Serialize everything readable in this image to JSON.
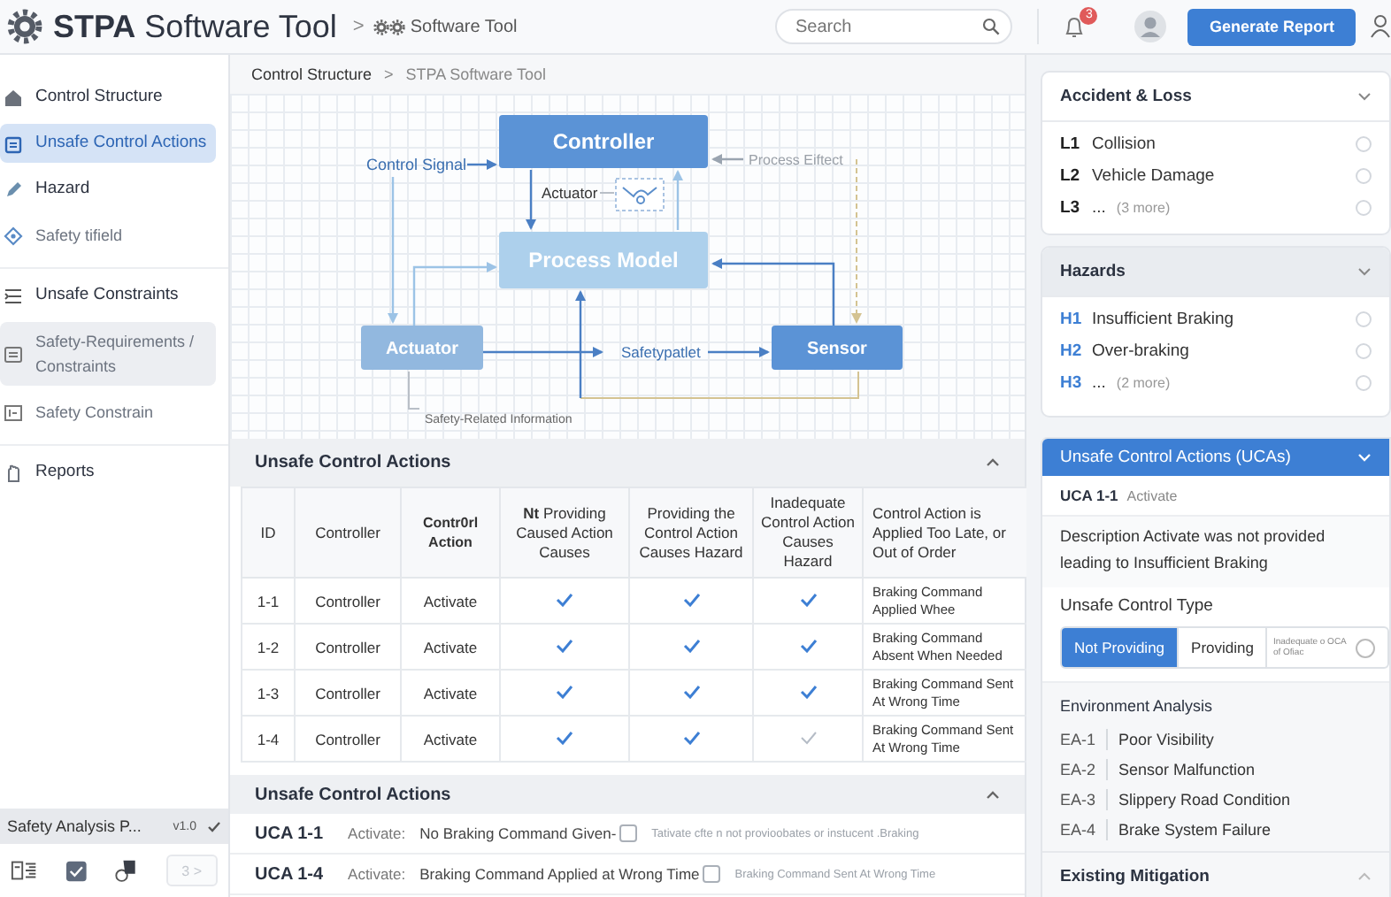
{
  "header": {
    "app_title": "**STPA** Software Tool",
    "breadcrumb_separator": ">",
    "breadcrumb": "Software Tool",
    "search": {
      "placeholder": "Search"
    },
    "notification_count": "3",
    "button": "Generate Report"
  },
  "sidebar": {
    "groups": [
      {
        "items": [
          {
            "label": "Control Structure",
            "kind": "heading",
            "selected": false,
            "highlighted": false
          },
          {
            "label": "Unsafe Control Actions",
            "kind": "heading",
            "selected": true,
            "highlighted": false
          },
          {
            "label": "Hazard",
            "kind": "heading",
            "selected": false,
            "highlighted": false
          },
          {
            "label": "Safety tifield",
            "kind": "item",
            "selected": false,
            "highlighted": false
          }
        ]
      },
      {
        "items": [
          {
            "label": "Unsafe Constraints",
            "kind": "heading",
            "selected": false,
            "highlighted": false
          },
          {
            "label": "Safety-Requirements / Constraints",
            "kind": "item",
            "selected": false,
            "highlighted": true
          },
          {
            "label": "Safety Constrain",
            "kind": "item",
            "selected": false,
            "highlighted": false
          }
        ]
      },
      {
        "items": [
          {
            "label": "Reports",
            "kind": "heading",
            "selected": false,
            "highlighted": false
          }
        ]
      }
    ],
    "status": {
      "project": "Safety Analysis P...",
      "version": "v1.0"
    },
    "page_button": {
      "label": "3 >",
      "disabled": true
    }
  },
  "breadcrumb": {
    "items": [
      "Control Structure",
      "STPA Software Tool"
    ],
    "separator": ">"
  },
  "diagram": {
    "nodes": [
      {
        "label": "Controller",
        "kind": "primary"
      },
      {
        "label": "Process Model",
        "kind": "faded"
      },
      {
        "label": "Actuator",
        "kind": "secondary"
      },
      {
        "label": "Sensor",
        "kind": "primary"
      }
    ],
    "labels": [
      {
        "text": "Control Signal",
        "kind": "signal"
      },
      {
        "text": "Process Eiftect",
        "kind": "effect"
      },
      {
        "text": "Actuator",
        "kind": "plain"
      },
      {
        "text": "Safetypatlet",
        "kind": "flow"
      },
      {
        "text": "Safety-Related Information",
        "kind": "note"
      }
    ]
  },
  "uca_table": {
    "title": "Unsafe Control Actions",
    "columns": [
      {
        "label": "ID",
        "emphasis": false
      },
      {
        "label": "Controller",
        "emphasis": false
      },
      {
        "label": "Contr0rl Action",
        "emphasis": true
      },
      {
        "label": "**Nt** Providing Caused Action Causes",
        "emphasis": false
      },
      {
        "label": "Providing the Control Action Causes Hazard",
        "emphasis": false
      },
      {
        "label": "Inadequate Control Action Causes Hazard",
        "emphasis": false
      },
      {
        "label": "Control Action is Applied Too Late, or Out of Order",
        "emphasis": false
      }
    ],
    "rows": [
      {
        "id": "1-1",
        "controller": "Controller",
        "action": "Activate",
        "checks": [
          true,
          true,
          true
        ],
        "context": "Braking Command Applied Whee"
      },
      {
        "id": "1-2",
        "controller": "Controller",
        "action": "Activate",
        "checks": [
          true,
          true,
          true
        ],
        "context": "Braking Command Absent When Needed"
      },
      {
        "id": "1-3",
        "controller": "Controller",
        "action": "Activate",
        "checks": [
          true,
          true,
          true
        ],
        "context": "Braking Command Sent At Wrong Time"
      },
      {
        "id": "1-4",
        "controller": "Controller",
        "action": "Activate",
        "checks": [
          true,
          true,
          false
        ],
        "context": "Braking Command Sent At Wrong Time"
      }
    ]
  },
  "uca_list": {
    "title": "Unsafe Control Actions",
    "items": [
      {
        "id": "UCA 1-1",
        "action": "Activate:",
        "text": "No Braking Command Given-",
        "checked": false,
        "note": "Tativate cfte n not provioobates or instucent .Braking"
      },
      {
        "id": "UCA 1-4",
        "action": "Activate:",
        "text": "Braking Command Applied at Wrong Time",
        "checked": false,
        "note": "Braking Command Sent At Wrong Time"
      }
    ]
  },
  "accident_loss": {
    "title": "Accident & Loss",
    "items": [
      {
        "id": "L1",
        "label": "Collision",
        "selected": false
      },
      {
        "id": "L2",
        "label": "Vehicle Damage",
        "selected": false
      },
      {
        "id": "L3",
        "label": "...",
        "more": "(3 more)",
        "selected": false
      }
    ]
  },
  "hazards": {
    "title": "Hazards",
    "items": [
      {
        "id": "H1",
        "label": "Insufficient Braking",
        "selected": false
      },
      {
        "id": "H2",
        "label": "Over-braking",
        "selected": false
      },
      {
        "id": "H3",
        "label": "...",
        "more": "(2 more)",
        "selected": false
      }
    ]
  },
  "uca_detail": {
    "title": "Unsafe Control Actions (UCAs)",
    "id": "UCA 1-1",
    "action": "Activate",
    "description": "Description Activate was not provided leading to Insufficient Braking",
    "type_label": "Unsafe Control Type",
    "types": [
      {
        "label": "Not Providing",
        "selected": true
      },
      {
        "label": "Providing",
        "selected": false
      },
      {
        "label": "Inadequate o OCA of Ofiac",
        "selected": false
      }
    ],
    "toggle_on": false,
    "environment": {
      "title": "Environment Analysis",
      "items": [
        {
          "id": "EA-1",
          "label": "Poor Visibility"
        },
        {
          "id": "EA-2",
          "label": "Sensor Malfunction"
        },
        {
          "id": "EA-3",
          "label": "Slippery Road Condition"
        },
        {
          "id": "EA-4",
          "label": "Brake System Failure"
        }
      ]
    },
    "mitigation": {
      "title": "Existing Mitigation"
    }
  }
}
